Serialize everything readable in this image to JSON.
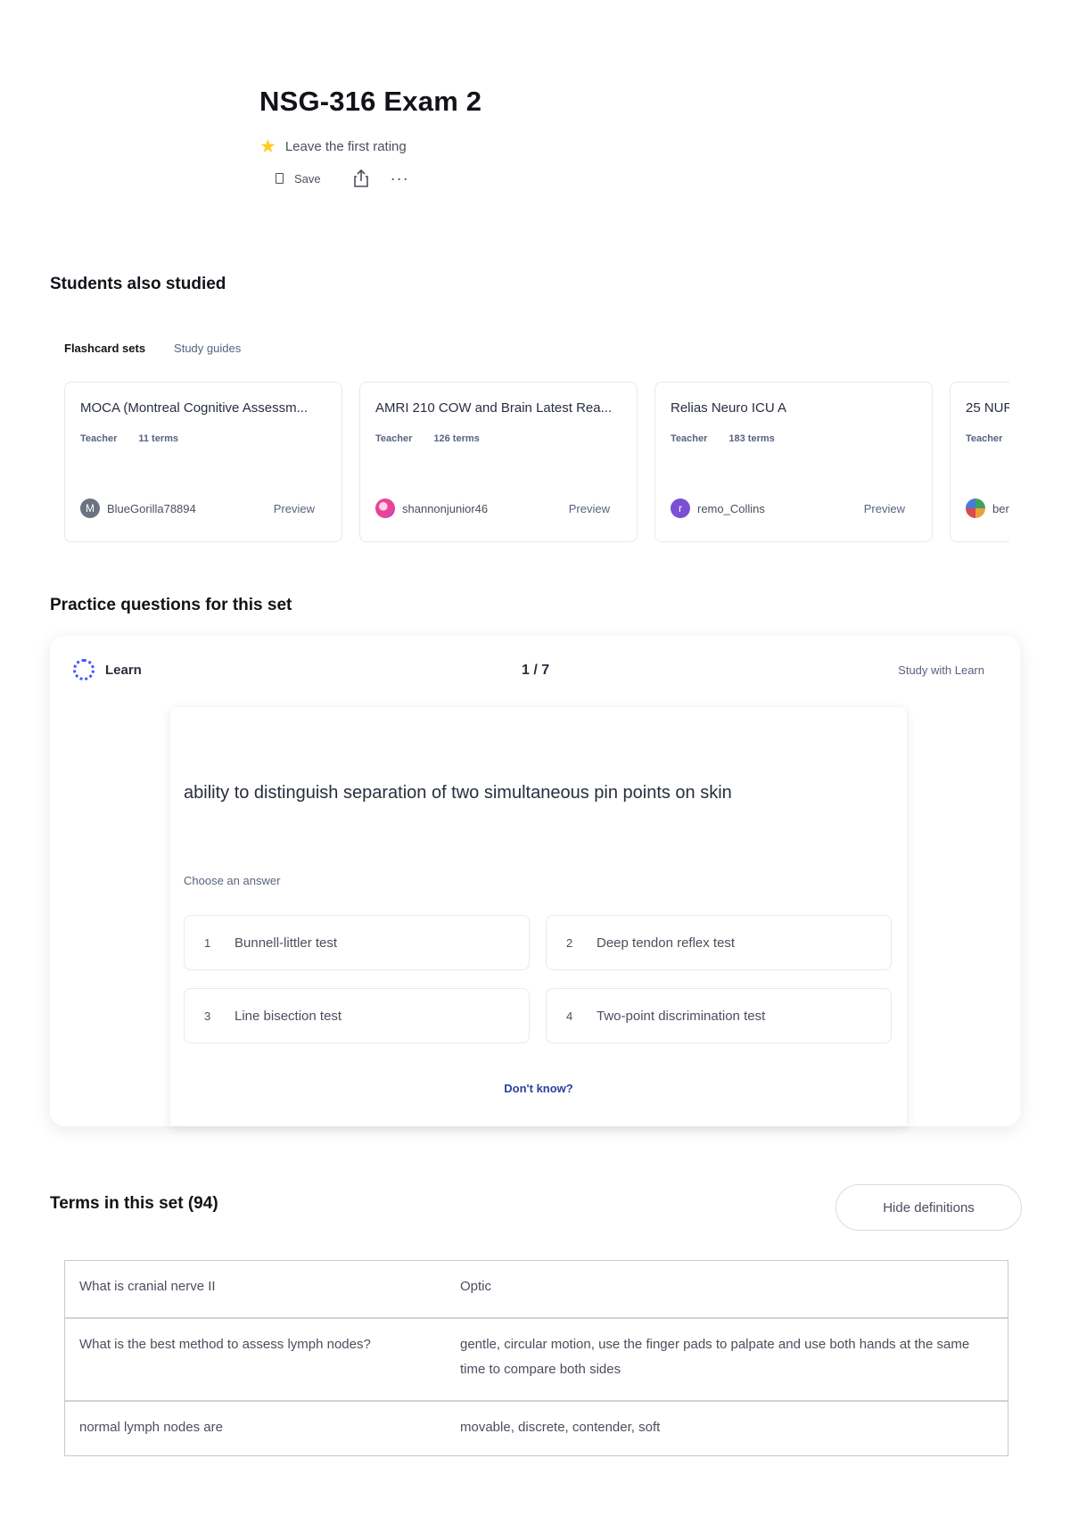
{
  "header": {
    "title": "NSG-316 Exam 2",
    "rating_text": "Leave the first rating",
    "save_label": "Save"
  },
  "students_also_studied": {
    "title": "Students also studied",
    "tabs": [
      {
        "label": "Flashcard sets",
        "active": true
      },
      {
        "label": "Study guides",
        "active": false
      }
    ],
    "cards": [
      {
        "title": "MOCA (Montreal Cognitive Assessm...",
        "role": "Teacher",
        "terms": "11 terms",
        "user": "BlueGorilla78894",
        "avatar_letter": "M",
        "avatar_color": "#6b7280",
        "preview": "Preview"
      },
      {
        "title": "AMRI 210 COW and Brain Latest Rea...",
        "role": "Teacher",
        "terms": "126 terms",
        "user": "shannonjunior46",
        "avatar_letter": "",
        "avatar_color": "#e8439a",
        "preview": "Preview"
      },
      {
        "title": "Relias Neuro ICU A",
        "role": "Teacher",
        "terms": "183 terms",
        "user": "remo_Collins",
        "avatar_letter": "r",
        "avatar_color": "#7b4fd6",
        "preview": "Preview"
      },
      {
        "title": "25 NUR",
        "role": "Teacher",
        "terms": "",
        "user": "ber",
        "avatar_letter": "",
        "avatar_color": "#3aa35c",
        "preview": ""
      }
    ]
  },
  "practice": {
    "title": "Practice questions for this set",
    "mode_label": "Learn",
    "progress": "1 / 7",
    "study_link": "Study with Learn",
    "question": "ability to distinguish separation of two simultaneous pin points on skin",
    "choose_label": "Choose an answer",
    "options": [
      {
        "num": "1",
        "label": "Bunnell-littler test"
      },
      {
        "num": "2",
        "label": "Deep tendon reflex test"
      },
      {
        "num": "3",
        "label": "Line bisection test"
      },
      {
        "num": "4",
        "label": "Two-point discrimination test"
      }
    ],
    "dont_know": "Don't know?"
  },
  "terms": {
    "title": "Terms in this set (94)",
    "hide_button": "Hide definitions",
    "rows": [
      {
        "term": "What is cranial nerve II",
        "definition": "Optic"
      },
      {
        "term": "What is the best method to assess lymph nodes?",
        "definition": "gentle, circular motion, use the finger pads to palpate and use both hands at the same time to compare both sides"
      },
      {
        "term": "normal lymph nodes are",
        "definition": "movable, discrete, contender, soft"
      }
    ]
  },
  "colors": {
    "accent": "#4255ff",
    "star": "#ffcd1f",
    "link": "#2e3f9e"
  }
}
